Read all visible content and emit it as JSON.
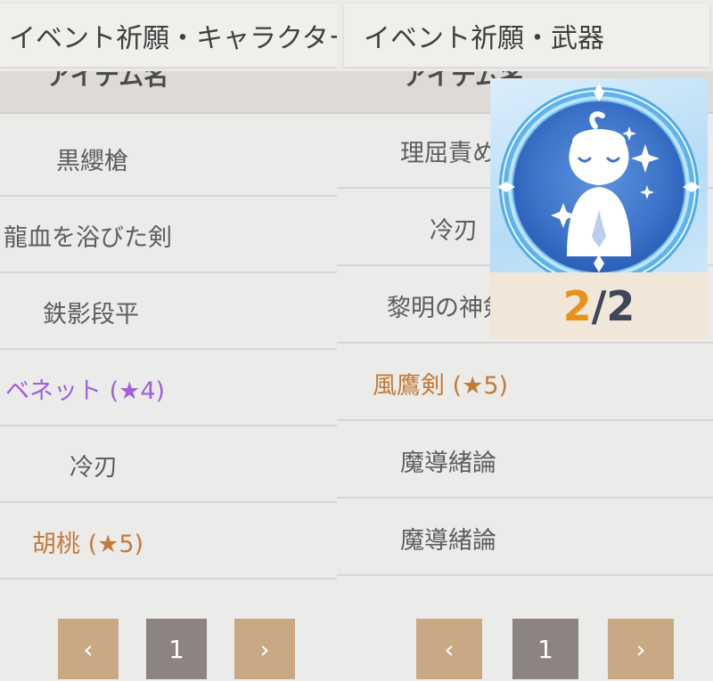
{
  "left_panel": {
    "title": "イベント祈願・キャラクター",
    "column_header": "アイテム名",
    "rows": [
      {
        "label": "黒纓槍"
      },
      {
        "label": "龍血を浴びた剣"
      },
      {
        "label": "鉄影段平"
      },
      {
        "label": "ベネット (★4)",
        "rarity": 4
      },
      {
        "label": "冷刃"
      },
      {
        "label": "胡桃 (★5)",
        "rarity": 5
      }
    ],
    "pagination": {
      "prev": "‹",
      "page": "1",
      "next": "›"
    }
  },
  "right_panel": {
    "title": "イベント祈願・武器",
    "column_header": "アイテム名",
    "rows": [
      {
        "label": "理屈責め"
      },
      {
        "label": "冷刃"
      },
      {
        "label": "黎明の神剣"
      },
      {
        "label": "風鷹剣 (★5)",
        "rarity": 5
      },
      {
        "label": "魔導緒論"
      },
      {
        "label": "魔導緒論"
      }
    ],
    "pagination": {
      "prev": "‹",
      "page": "1",
      "next": "›"
    }
  },
  "popup": {
    "icon": "praying-spirit-icon",
    "counter_current": "2",
    "counter_separator": "/",
    "counter_total": "2"
  },
  "colors": {
    "rarity_4": "#a05fdd",
    "rarity_5": "#c47b3a",
    "nav_button": "#c9a884",
    "page_button": "#8b8480",
    "counter_highlight": "#e8921b"
  }
}
